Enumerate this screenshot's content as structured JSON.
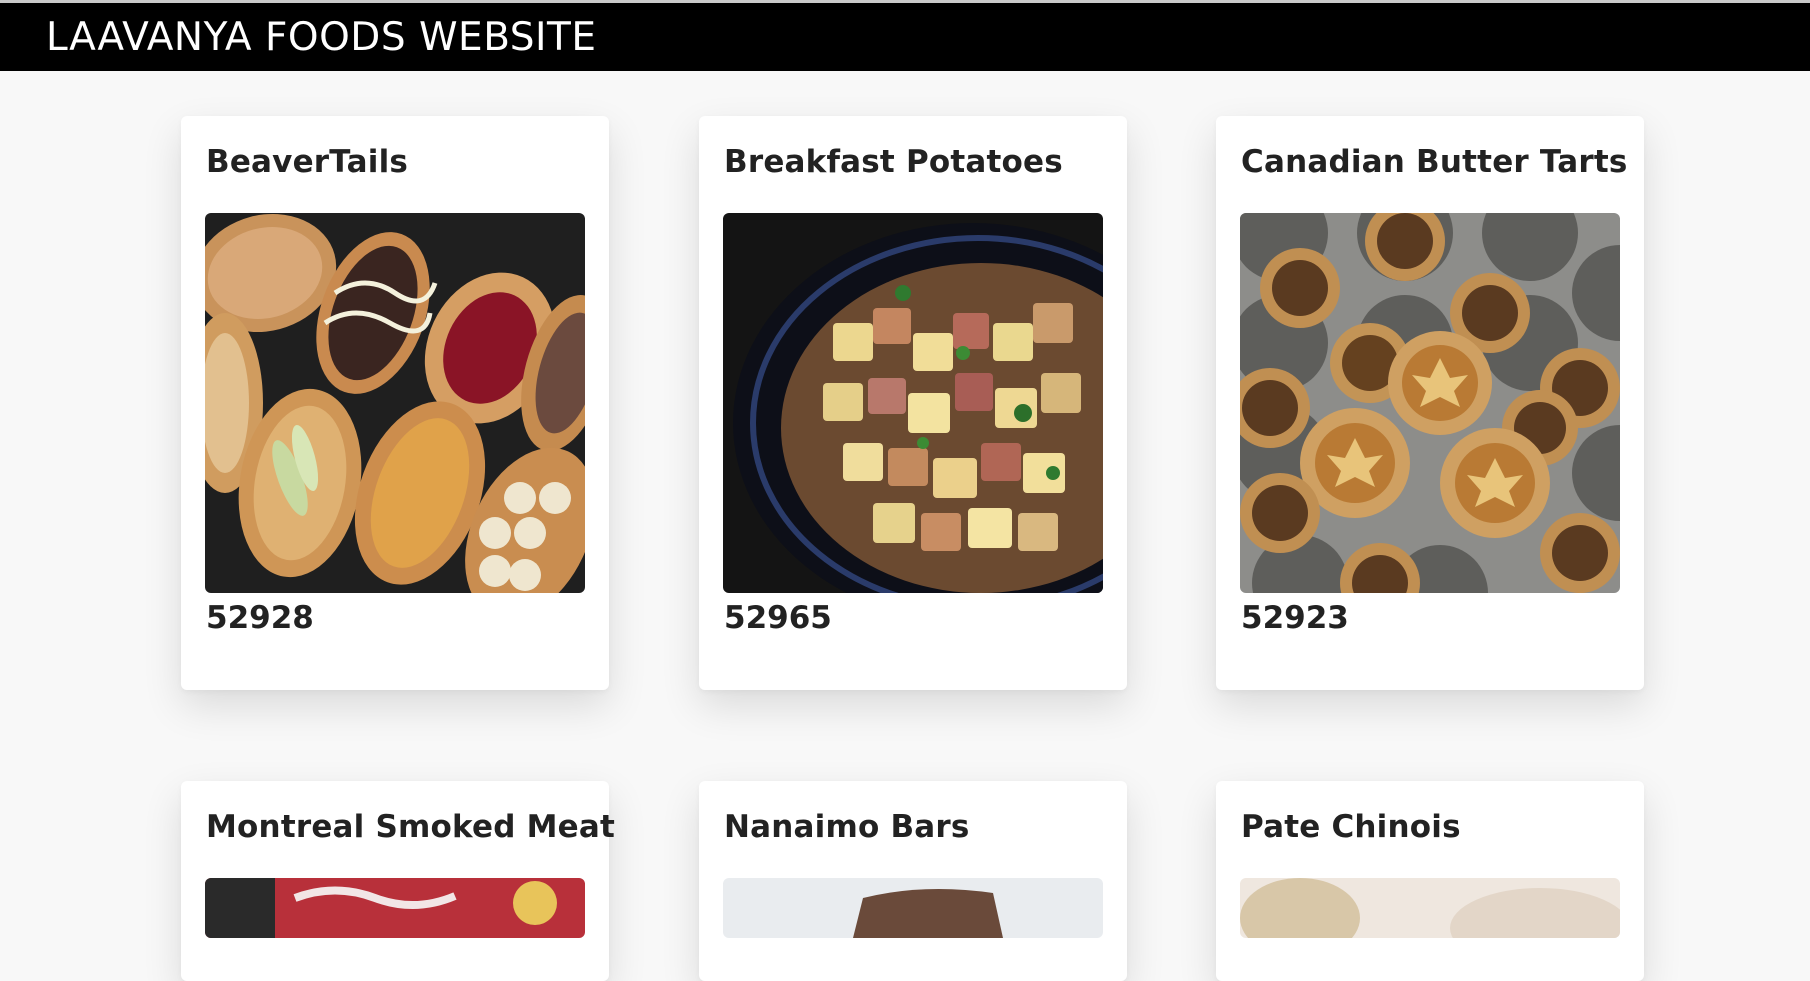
{
  "header": {
    "brand": "LAAVANYA FOODS WEBSITE"
  },
  "cards": [
    {
      "title": "BeaverTails",
      "id": "52928",
      "image": "beavertails-photo"
    },
    {
      "title": "Breakfast Potatoes",
      "id": "52965",
      "image": "breakfast-potatoes-photo"
    },
    {
      "title": "Canadian Butter Tarts",
      "id": "52923",
      "image": "butter-tarts-photo"
    },
    {
      "title": "Montreal Smoked Meat",
      "id": "",
      "image": "smoked-meat-photo"
    },
    {
      "title": "Nanaimo Bars",
      "id": "",
      "image": "nanaimo-bars-photo"
    },
    {
      "title": "Pate Chinois",
      "id": "",
      "image": "pate-chinois-photo"
    }
  ]
}
